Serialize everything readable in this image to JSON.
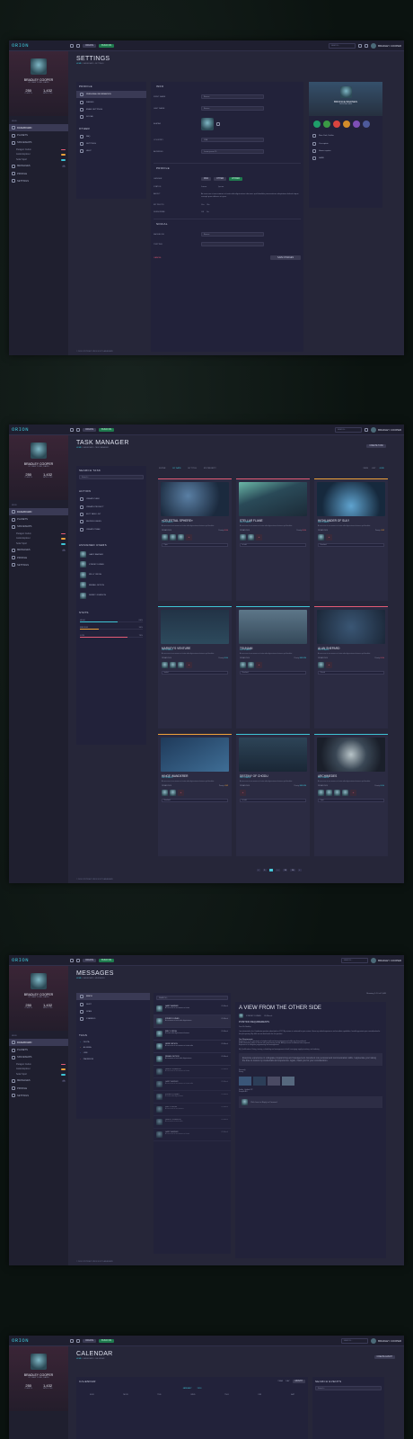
{
  "app": {
    "logo": "ORION",
    "user": "BRADLEY COOPER",
    "create": "CREATE",
    "badge": "BUILD 001",
    "search": "SEARCH..."
  },
  "profile": {
    "name": "BRADLEY COOPER",
    "location": "ST. NEW YORK, DAVIS",
    "planets": "250",
    "planets_label": "PLANETS",
    "satellites": "1,432",
    "satellites_label": "SATELLITES"
  },
  "nav": {
    "header": "MENU",
    "items": [
      "DASHBOARD",
      "PLANETS",
      "SPACESHIPS",
      "MESSAGES",
      "PROFILE",
      "SETTINGS"
    ],
    "subs": [
      "Paragon Cudon",
      "Astral Explorer",
      "Solar Sport"
    ],
    "badge_messages": "3"
  },
  "footer": "© 2016 COPYRIGHT ORION UI KIT DASHBOARD",
  "settings": {
    "title": "SETTINGS",
    "crumb": [
      "HOME",
      "DASHBOARD",
      "SETTINGS"
    ],
    "profile_h": "PROFILE",
    "profile_items": [
      "PERSONAL INFORMATION",
      "IMAGES",
      "EMAIL SETTINGS",
      "SOCIAL"
    ],
    "other_h": "OTHER",
    "other_items": [
      "FAQ",
      "SETTINGS",
      "HELP"
    ],
    "info_h": "INFO",
    "labels": [
      "FIRST NAME",
      "LAST NAME",
      "AVATAR",
      "COUNTRY",
      "ADDRESS"
    ],
    "values": [
      "Bronce",
      "Barnes",
      "",
      "USA",
      "Lorem ipsum 55"
    ],
    "profile2_h": "PROFILE",
    "p_labels": [
      "GENDER",
      "STATUS",
      "ABOUT",
      "MY PHOTO",
      "SUBSCRIBE"
    ],
    "gender": [
      "MAN",
      "OTHER",
      "WOMEN"
    ],
    "status": [
      "Lorem",
      "Ipsum"
    ],
    "about": "At vero eos et accusamus et iusto odio dignissimos ducimus qui blanditiis praesentium voluptatum deleniti atque corrupti quos dolores et quas",
    "yes_no": [
      "Yes",
      "No"
    ],
    "on_off": [
      "Off",
      "On"
    ],
    "social_h": "SOCIAL",
    "s_labels": [
      "FACEBOOK",
      "TWITTER"
    ],
    "s_values": [
      "Bronce",
      ""
    ],
    "cancel": "CANCEL",
    "save": "SAVE CHANGES",
    "card_name": "BRONCE BARNES",
    "card_sub": "PERSONAL RANK",
    "info_list": [
      "New York, Dahlia",
      "Co-captain",
      "Home captain",
      "SAND"
    ]
  },
  "tasks": {
    "title": "TASK MANAGER",
    "crumb": [
      "HOME",
      "DASHBOARD",
      "TASK MANAGER"
    ],
    "new_btn": "CREATE TASK",
    "search_h": "SEARCH TASK",
    "search_ph": "Search...",
    "action_h": "ACTION",
    "actions": [
      "CREATE TASK",
      "CREATE PROJECT",
      "EDIT TASK LIST",
      "REVIEW USERS",
      "CREATE TEAM"
    ],
    "users_h": "ASSIGNED USERS",
    "users": [
      "GARY BANNER",
      "STEREY DUNED",
      "WILLY ORIOH",
      "REMALL MITION",
      "DENNY JOHNSON"
    ],
    "stats_h": "STATS",
    "stats": [
      [
        "HIGH",
        "60%"
      ],
      [
        "MEDIUM",
        "30%"
      ],
      [
        "LOW",
        "75%"
      ]
    ],
    "filter": [
      "FILTER",
      "BY DATE",
      "BY TITLE",
      "BY PRIORITY"
    ],
    "view": [
      "VIEW",
      "LIST",
      "GRID"
    ],
    "cards": [
      {
        "t": "«CELESTIAL SPHERE»",
        "s": "DUE: 16 MARCH",
        "p": "Priority",
        "pv": "HIGH",
        "date": "28.MAR.2016",
        "st": "Open"
      },
      {
        "t": "STELLAR FLAME",
        "s": "DUE: 12 MARCH",
        "p": "Priority",
        "pv": "HIGH",
        "date": "28.MAR.2016",
        "st": "In hold"
      },
      {
        "t": "HIGHLANDER OF SULY",
        "s": "DUE: 12 MARCH",
        "p": "Priority",
        "pv": "LOW",
        "date": "28.MAR.2016",
        "st": "Resolved"
      },
      {
        "t": "MARKEY'S VENTURE",
        "s": "DUE: 20 MARCH",
        "p": "Priority",
        "pv": "HIGH",
        "date": "28.MAR.2016",
        "st": "Invalid"
      },
      {
        "t": "TSUNAMI",
        "s": "DUE: 18 MARCH",
        "p": "Priority",
        "pv": "MEDIUM",
        "date": "28.MAR.2016",
        "st": "Resolved"
      },
      {
        "t": "ALAN SHEPARD",
        "s": "DUE: 22 MARCH",
        "p": "Priority",
        "pv": "HIGH",
        "date": "28.MAR.2016",
        "st": "Closed"
      },
      {
        "t": "HINGE WANDERER",
        "s": "DUE: 16 MARCH",
        "p": "Priority",
        "pv": "LOW",
        "date": "28.MAR.2016",
        "st": "Resolved"
      },
      {
        "t": "DESTINY OF CHODU",
        "s": "DUE: 11 MARCH",
        "p": "Priority",
        "pv": "MEDIUM",
        "date": "28.MAR.2016",
        "st": "In hold"
      },
      {
        "t": "ARCHIMEDES",
        "s": "DUE: 11 MARCH",
        "p": "Priority",
        "pv": "HIGH",
        "date": "28.MAR.2016",
        "st": "Open"
      }
    ],
    "desc": "At vero eos et accusamus et iusto odio dignissimos ducimus qui blanditiis",
    "pages": [
      "‹",
      "1",
      "2",
      "...",
      "15",
      "16",
      "›"
    ]
  },
  "messages": {
    "title": "MESSAGES",
    "crumb": [
      "HOME",
      "DASHBOARD",
      "MESSAGES"
    ],
    "folders": [
      "INBOX",
      "SENT",
      "SPAM",
      "STARRED"
    ],
    "tags_h": "TAGS",
    "tags": [
      "DELTA",
      "ALGEBA",
      "LINE",
      "PAKIRROR"
    ],
    "search_ph": "SEARCH...",
    "count": "Showing 1-10 of 2,440",
    "list": [
      [
        "GARY BANNER",
        "At vero eos et accusamus et iusto"
      ],
      [
        "STEREY DUNED",
        "Accusamus et iusto odio dignissimos"
      ],
      [
        "WILLY ORIOH",
        "Et iusto odio dignissimos ducimus"
      ],
      [
        "JERRY ATSON",
        "At vero eos et accusamus et iusto odio"
      ],
      [
        "REMALL MITION",
        "Accusamus et iusto odio dignissimos"
      ],
      [
        "DENNY JOHNSON",
        "At vero eos et accusamus et iusto"
      ],
      [
        "GARY BANNER",
        "At vero eos et accusamus et iusto odio"
      ],
      [
        "STEREY DUNED",
        "Et iusto odio dignissimos"
      ],
      [
        "WILLY ORIOH",
        "At vero eos et accusamus"
      ],
      [
        "DENNY JOHNSON",
        "Accusamus et iusto odio"
      ],
      [
        "GARY BANNER",
        "At vero eos et accusamus et iusto"
      ]
    ],
    "time": "05 March",
    "subject": "A VIEW FROM THE OTHER SIDE",
    "from": "STEREY DUNED",
    "sub_h": "POSITION REQUIREMENTS",
    "greet": "Dear Mr. Bradley",
    "body": "I am interested in the Coordinator position advertised on XYZ. My resume is enclosed for your review. Given my related experience and excellent capabilities I would appreciate your consideration for this job opening. My skills are an ideal match for this position.",
    "req_h": "Your Requirements:",
    "reqs": [
      "Experience in the supervision of student staff and strong interpersonal skills are also preferred.",
      "Solid Information about a Sunset with good closing record. Ability to travel to different sites required.",
      "Experience in collegiate programming and management."
    ],
    "body2": "My Qualifications: Hiring, training, scheduling and management of staff, managing supply inventory, and ordering.",
    "quote": "Extensive experience in collegiate programming and management. Excellent role personal and communication skills. I appreciate your taking the time to review my credentials and experience. Again, thank you for your consideration.",
    "sign": [
      "Sincerely,",
      "Sterey"
    ],
    "files": [
      "Folder_Untitled.ZIP",
      "Sample.AVI"
    ],
    "reply": "Click here to Reply or Forward"
  },
  "calendar": {
    "title": "CALENDAR",
    "crumb": [
      "HOME",
      "DASHBOARD",
      "CALENDAR"
    ],
    "btn": "CREATE EVENT",
    "cal_h": "CALENDAR",
    "views": [
      "YEAR",
      "DAY",
      "MONTH"
    ],
    "month": "JANUARY",
    "year": "2016",
    "search_h": "SEARCH EVENTS",
    "search_ph": "Search...",
    "days": [
      "SUN",
      "MON",
      "TUE",
      "WED",
      "THU",
      "FRI",
      "SAT"
    ]
  }
}
